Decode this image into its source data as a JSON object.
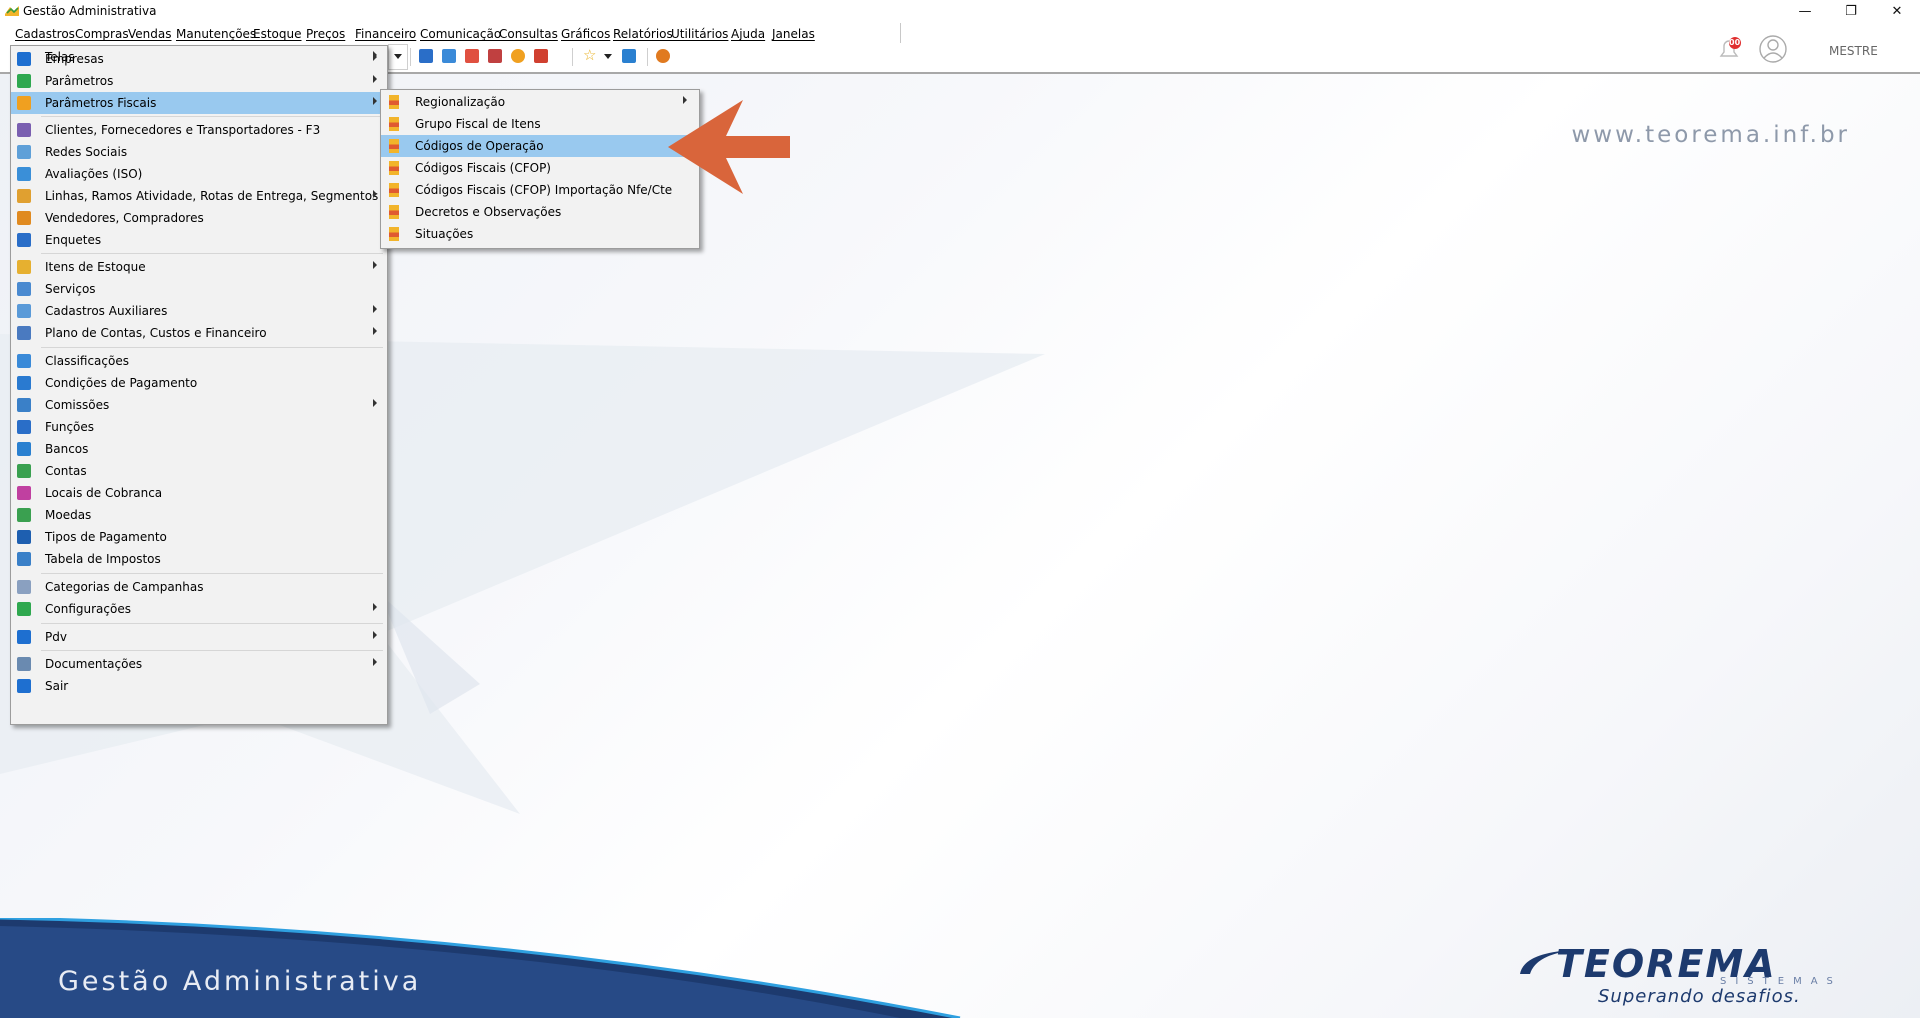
{
  "window": {
    "title": "Gestão Administrativa",
    "minimize": "—",
    "restore": "❐",
    "close": "✕"
  },
  "menubar": [
    "Cadastros",
    "Compras",
    "Vendas",
    "Manutenções",
    "Estoque",
    "Preços",
    "Financeiro",
    "Comunicação",
    "Consultas",
    "Gráficos",
    "Relatórios",
    "Utilitários",
    "Ajuda",
    "Janelas"
  ],
  "user": {
    "name": "MESTRE",
    "notifications": "00"
  },
  "background": {
    "website": "www.teorema.inf.br",
    "footer_title": "Gestão Administrativa"
  },
  "logo": {
    "brand": "TEOREMA",
    "sub": "SISTEMAS",
    "slogan": "Superando desafios."
  },
  "cadastros_menu": [
    {
      "label": "Empresas",
      "icon": "company-icon",
      "color": "#1e6fd0",
      "submenu": true
    },
    {
      "label": "Parâmetros",
      "icon": "grid-icon",
      "color": "#2fa84f",
      "submenu": true
    },
    {
      "label": "Parâmetros Fiscais",
      "icon": "fiscal-icon",
      "color": "#f0a020",
      "submenu": true,
      "highlighted": true
    },
    {
      "label": "Clientes, Fornecedores e Transportadores - F3",
      "icon": "people-icon",
      "color": "#7a5fb0",
      "submenu": false
    },
    {
      "label": "Redes Sociais",
      "icon": "share-icon",
      "color": "#5fa0d8",
      "submenu": false
    },
    {
      "label": "Avaliações (ISO)",
      "icon": "chart-icon",
      "color": "#3a8fd8",
      "submenu": false
    },
    {
      "label": "Linhas, Ramos Atividade, Rotas de Entrega, Segmentos",
      "icon": "tree-icon",
      "color": "#e0a030",
      "submenu": true
    },
    {
      "label": "Vendedores, Compradores",
      "icon": "person-icon",
      "color": "#e08a20",
      "submenu": false
    },
    {
      "label": "Enquetes",
      "icon": "list-icon",
      "color": "#2a6ec8",
      "submenu": false
    },
    {
      "label": "Itens de Estoque",
      "icon": "box-icon",
      "color": "#e6b030",
      "submenu": true
    },
    {
      "label": "Serviços",
      "icon": "service-icon",
      "color": "#4a8ad0",
      "submenu": false
    },
    {
      "label": "Cadastros Auxiliares",
      "icon": "aux-icon",
      "color": "#5a9ad8",
      "submenu": true
    },
    {
      "label": "Plano de Contas, Custos e Financeiro",
      "icon": "accounts-icon",
      "color": "#4a7ac0",
      "submenu": true
    },
    {
      "label": "Classificações",
      "icon": "classify-icon",
      "color": "#3a8ad8",
      "submenu": false
    },
    {
      "label": "Condições de Pagamento",
      "icon": "payment-icon",
      "color": "#2a7ad0",
      "submenu": false
    },
    {
      "label": "Comissões",
      "icon": "commission-icon",
      "color": "#3a80c8",
      "submenu": true
    },
    {
      "label": "Funções",
      "icon": "function-icon",
      "color": "#2a6ec8",
      "submenu": false
    },
    {
      "label": "Bancos",
      "icon": "bank-icon",
      "color": "#2a80d0",
      "submenu": false
    },
    {
      "label": "Contas",
      "icon": "money-icon",
      "color": "#3aa050",
      "submenu": false
    },
    {
      "label": "Locais de Cobranca",
      "icon": "location-icon",
      "color": "#c040a0",
      "submenu": false
    },
    {
      "label": "Moedas",
      "icon": "coin-icon",
      "color": "#3aa050",
      "submenu": false
    },
    {
      "label": "Tipos de Pagamento",
      "icon": "card-icon",
      "color": "#1e5fb0",
      "submenu": false
    },
    {
      "label": "Tabela de Impostos",
      "icon": "table-icon",
      "color": "#3a80c8",
      "submenu": false
    },
    {
      "label": "Categorias de Campanhas",
      "icon": "category-icon",
      "color": "#8aa0c0",
      "submenu": false
    },
    {
      "label": "Configurações",
      "icon": "config-icon",
      "color": "#2fa84f",
      "submenu": true
    },
    {
      "label": "Pdv",
      "icon": "pos-icon",
      "color": "#1e6fd0",
      "submenu": true
    },
    {
      "label": "Documentações",
      "icon": "docs-icon",
      "color": "#6a8ab0",
      "submenu": true
    },
    {
      "label": "Sair",
      "icon": "exit-icon",
      "color": "#1e6fd0",
      "submenu": false
    },
    {
      "label": "Telas",
      "icon": "",
      "color": "",
      "submenu": true
    }
  ],
  "fiscal_submenu": [
    {
      "label": "Regionalização",
      "submenu": true
    },
    {
      "label": "Grupo Fiscal de Itens",
      "submenu": false
    },
    {
      "label": "Códigos de Operação",
      "submenu": false,
      "highlighted": true
    },
    {
      "label": "Códigos Fiscais (CFOP)",
      "submenu": false
    },
    {
      "label": "Códigos Fiscais (CFOP)  Importação Nfe/Cte",
      "submenu": false
    },
    {
      "label": "Decretos e Observações",
      "submenu": false
    },
    {
      "label": "Situações",
      "submenu": false
    }
  ],
  "colors": {
    "highlight": "#99c9ef",
    "arrow": "#d9653b",
    "menu_bg": "#f2f2f2"
  }
}
